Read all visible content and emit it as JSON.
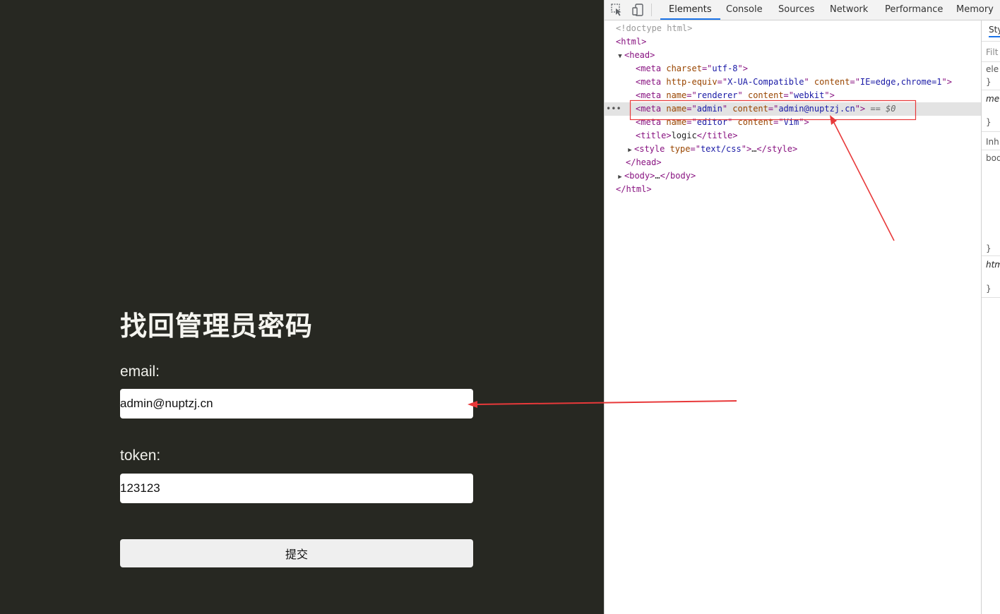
{
  "page": {
    "heading": "找回管理员密码",
    "email_label": "email:",
    "email_value": "admin@nuptzj.cn",
    "token_label": "token:",
    "token_value": "123123",
    "submit_label": "提交"
  },
  "devtools": {
    "tabs": [
      "Elements",
      "Console",
      "Sources",
      "Network",
      "Performance",
      "Memory"
    ],
    "active_tab": "Elements",
    "styles_tab_partial": "Sty",
    "styles_filter_partial": "Filt",
    "styles_lines": [
      "ele",
      "}",
      "met",
      "}",
      "Inh",
      "bod",
      "}",
      "htm",
      "}"
    ],
    "dom_lines": {
      "doctype": "<!doctype html>",
      "html_open": "<html>",
      "head_open": "<head>",
      "meta_charset": {
        "name": "charset",
        "value": "utf-8"
      },
      "meta_http": {
        "name1": "http-equiv",
        "value1": "X-UA-Compatible",
        "name2": "content",
        "value2": "IE=edge,chrome=1"
      },
      "meta_renderer": {
        "name1": "name",
        "value1": "renderer",
        "name2": "content",
        "value2": "webkit"
      },
      "meta_admin": {
        "name1": "name",
        "value1": "admin",
        "name2": "content",
        "value2": "admin@nuptzj.cn",
        "tail": "== $0"
      },
      "meta_editor": {
        "name1": "name",
        "value1": "editor",
        "name2": "content",
        "value2": "Vim"
      },
      "title_text": "logic",
      "style_type": {
        "name": "type",
        "value": "text/css"
      },
      "head_close": "</head>",
      "body": "<body>",
      "body_ellipsis": "…",
      "body_close": "</body>",
      "html_close": "</html>"
    }
  },
  "colors": {
    "page_bg": "#272822",
    "annotation_red": "#e8393a",
    "selection_bg": "#e3e3e3",
    "tag": "#881280",
    "attr_name": "#994500",
    "attr_value": "#1a1aa6"
  }
}
